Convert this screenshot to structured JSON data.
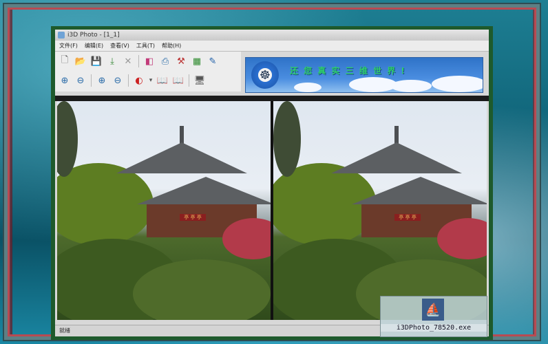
{
  "window": {
    "title": "i3D Photo - [1_1]"
  },
  "menu": [
    "文件(F)",
    "编辑(E)",
    "查看(V)",
    "工具(T)",
    "帮助(H)"
  ],
  "toolbar_row1": [
    {
      "icon": "new-file-icon",
      "glyph": "🗋"
    },
    {
      "icon": "open-folder-icon",
      "glyph": "📂"
    },
    {
      "icon": "save-icon",
      "glyph": "💾"
    },
    {
      "icon": "import-icon",
      "glyph": "⤓"
    },
    {
      "icon": "delete-icon",
      "glyph": "✕"
    },
    {
      "icon": "image-edit-icon",
      "glyph": "◧"
    },
    {
      "icon": "print-icon",
      "glyph": "⎙"
    },
    {
      "icon": "tools-icon",
      "glyph": "⚒"
    },
    {
      "icon": "layers-icon",
      "glyph": "▦"
    },
    {
      "icon": "settings-icon",
      "glyph": "✎"
    }
  ],
  "toolbar_row2": [
    {
      "icon": "zoom-in-icon",
      "glyph": "⊕"
    },
    {
      "icon": "zoom-out-icon",
      "glyph": "⊖"
    },
    {
      "icon": "zoom-fit-icon",
      "glyph": "⊕"
    },
    {
      "icon": "zoom-actual-icon",
      "glyph": "⊖"
    },
    {
      "icon": "color-mode-icon",
      "glyph": "◐"
    },
    {
      "icon": "dropdown-arrow-icon",
      "glyph": "▾"
    },
    {
      "icon": "book-open-icon",
      "glyph": "📖"
    },
    {
      "icon": "book-flip-icon",
      "glyph": "📖"
    },
    {
      "icon": "display-icon",
      "glyph": "🖥"
    }
  ],
  "banner": {
    "text": "还 您 真 实 三 维 世 界 !"
  },
  "photo_sign": "亭 亭 亭",
  "status": {
    "text": "就绪"
  },
  "desktop_file": {
    "label": "i3DPhoto_78520.exe"
  }
}
